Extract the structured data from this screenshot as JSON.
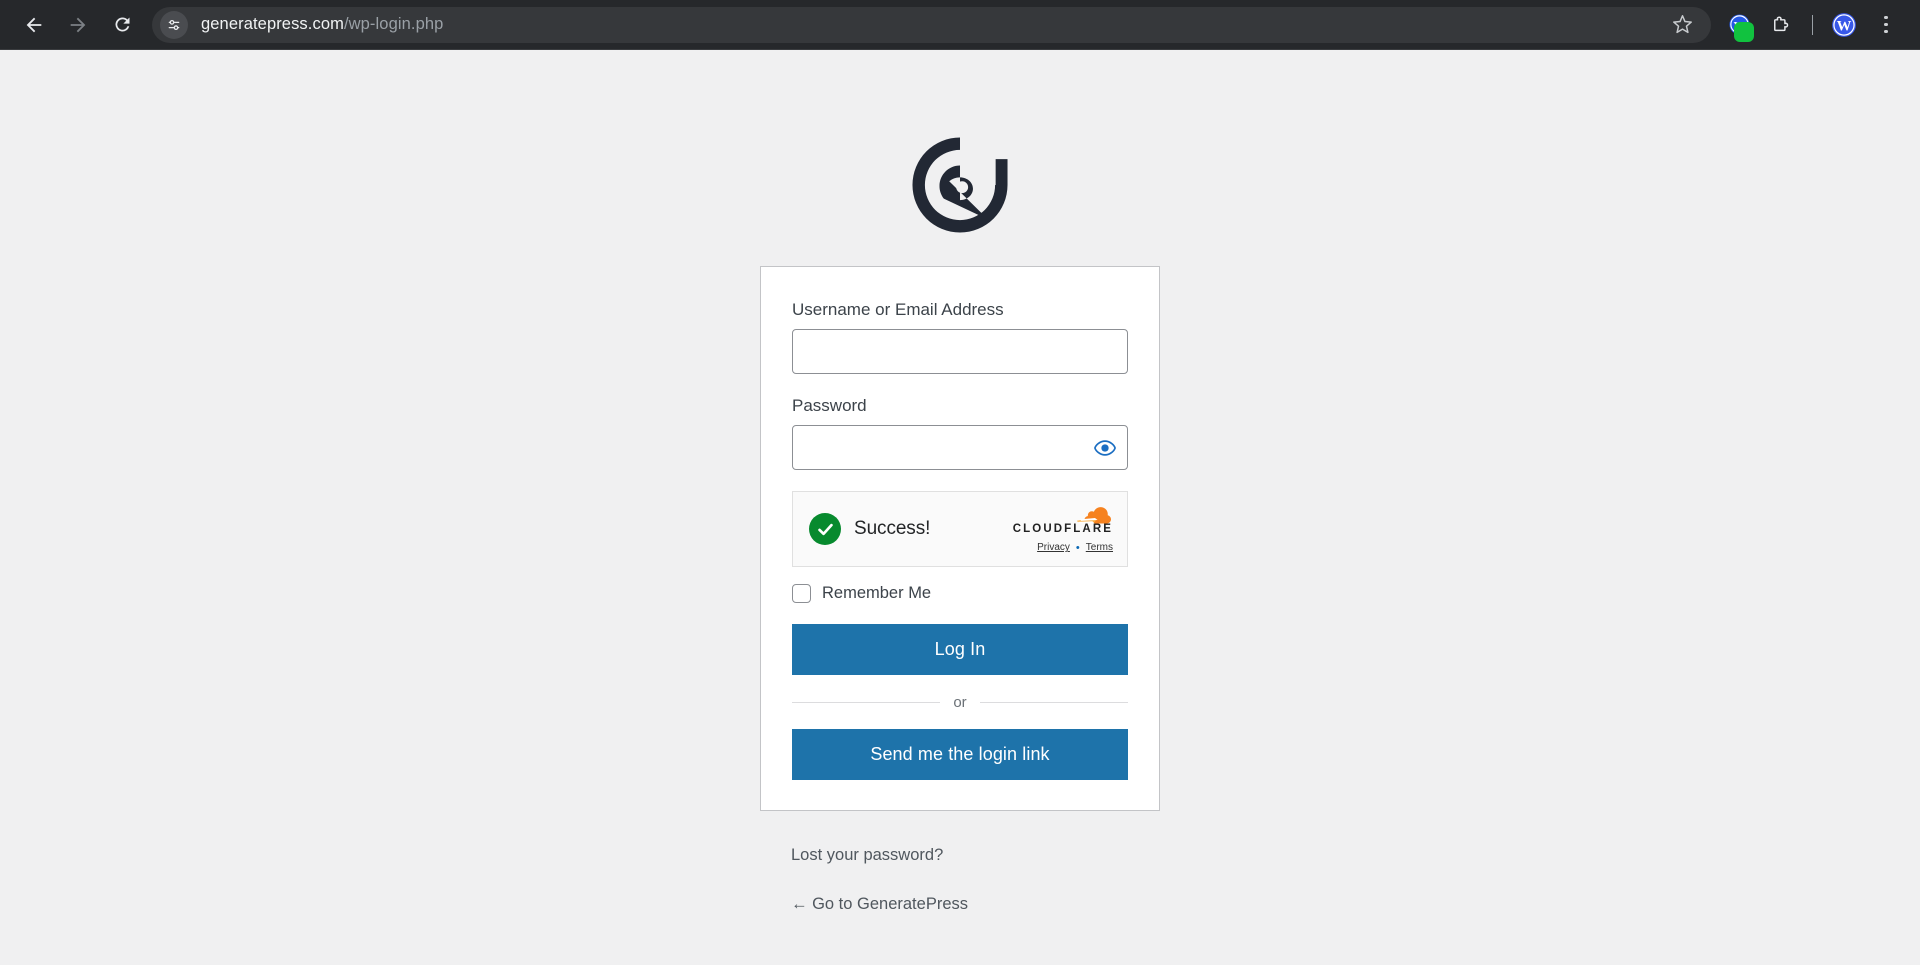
{
  "browser": {
    "back_label": "Back",
    "forward_label": "Forward",
    "reload_label": "Reload",
    "site_info_label": "View site information",
    "url_domain": "generatepress.com",
    "url_path": "/wp-login.php",
    "bookmark_label": "Bookmark this tab",
    "extension_badge_label": "Extension with green badge",
    "extensions_label": "Extensions",
    "wordpress_label": "WordPress",
    "menu_label": "Customize and control Chromium"
  },
  "login": {
    "logo_alt": "GeneratePress",
    "username_label": "Username or Email Address",
    "username_value": "",
    "username_placeholder": "",
    "password_label": "Password",
    "password_value": "",
    "password_placeholder": "",
    "show_password_label": "Show password",
    "turnstile": {
      "status_text": "Success!",
      "brand": "CLOUDFLARE",
      "privacy_label": "Privacy",
      "separator": "•",
      "terms_label": "Terms"
    },
    "remember_label": "Remember Me",
    "remember_checked": false,
    "submit_label": "Log In",
    "or_label": "or",
    "magic_link_label": "Send me the login link",
    "lost_password_label": "Lost your password?",
    "go_back_label": "← Go to GeneratePress"
  },
  "colors": {
    "accent_blue": "#1e73aa",
    "success_green": "#078a2e",
    "cloudflare_orange": "#f6821f",
    "page_bg": "#f0f0f1",
    "chrome_bg": "#26282b"
  }
}
